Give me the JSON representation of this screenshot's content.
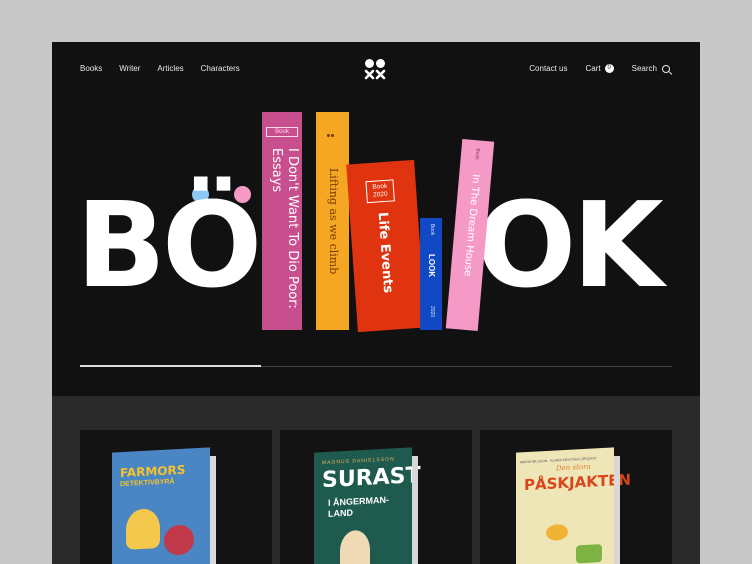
{
  "nav": {
    "links": [
      "Books",
      "Writer",
      "Articles",
      "Characters"
    ],
    "contact": "Contact us",
    "cart_label": "Cart",
    "cart_count": "0",
    "search_label": "Search"
  },
  "hero": {
    "word_left": "BÖ",
    "word_right": "OK",
    "books": [
      {
        "tag": "Book",
        "title": "I Don't Want To Dio Poor: Essays",
        "color": "#c84f8e"
      },
      {
        "tag": "",
        "title": "Lifting as we climb",
        "color": "#f5a623"
      },
      {
        "tag": "Book 2020",
        "title": "Life Events",
        "color": "#e0330f"
      },
      {
        "tag": "Book",
        "title": "LOOK",
        "year": "2020",
        "color": "#1149c4"
      },
      {
        "tag": "Book",
        "title": "In The Dream House",
        "color": "#f59ac6"
      }
    ]
  },
  "products": [
    {
      "title_line1": "FARMORS",
      "title_line2": "DETEKTIVBYRÅ",
      "bg": "#4a86c4"
    },
    {
      "author": "MAGNUS DANIELSSON",
      "title_line1": "SURAST",
      "title_line2": "I ÅNGERMAN-LAND",
      "bg": "#1e5a4e"
    },
    {
      "author": "MARIA NILSSON · KLARA KRISTINA LÖFQVIST",
      "title_line1": "Den stora",
      "title_line2": "PÅSKJAKTEN",
      "bg": "#efe6b8"
    }
  ]
}
